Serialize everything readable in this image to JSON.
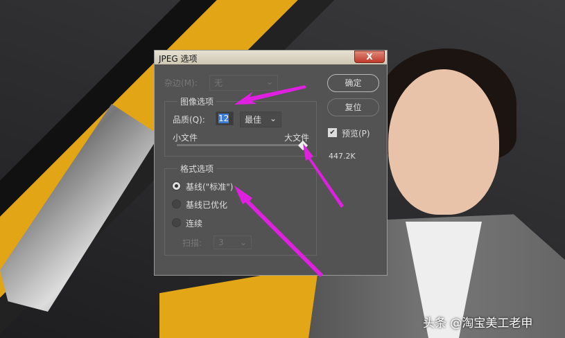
{
  "dialog": {
    "title": "JPEG 选项",
    "close": "X",
    "matte_label": "杂边(M):",
    "matte_value": "无",
    "image_options": "图像选项",
    "quality_label": "品质(Q):",
    "quality_value": "12",
    "quality_preset": "最佳",
    "small_file": "小文件",
    "large_file": "大文件",
    "slider_fraction": 1.0,
    "format_options": "格式选项",
    "formats": [
      {
        "label": "基线(\"标准\")",
        "selected": true
      },
      {
        "label": "基线已优化",
        "selected": false
      },
      {
        "label": "连续",
        "selected": false
      }
    ],
    "scans_label": "扫描:",
    "scans_value": "3",
    "ok": "确定",
    "reset": "复位",
    "preview_label": "预览(P)",
    "preview_checked": true,
    "file_size": "447.2K"
  },
  "watermark": "头条 @淘宝美工老申",
  "colors": {
    "accent": "#e020e0",
    "dialog_bg": "#535353"
  }
}
